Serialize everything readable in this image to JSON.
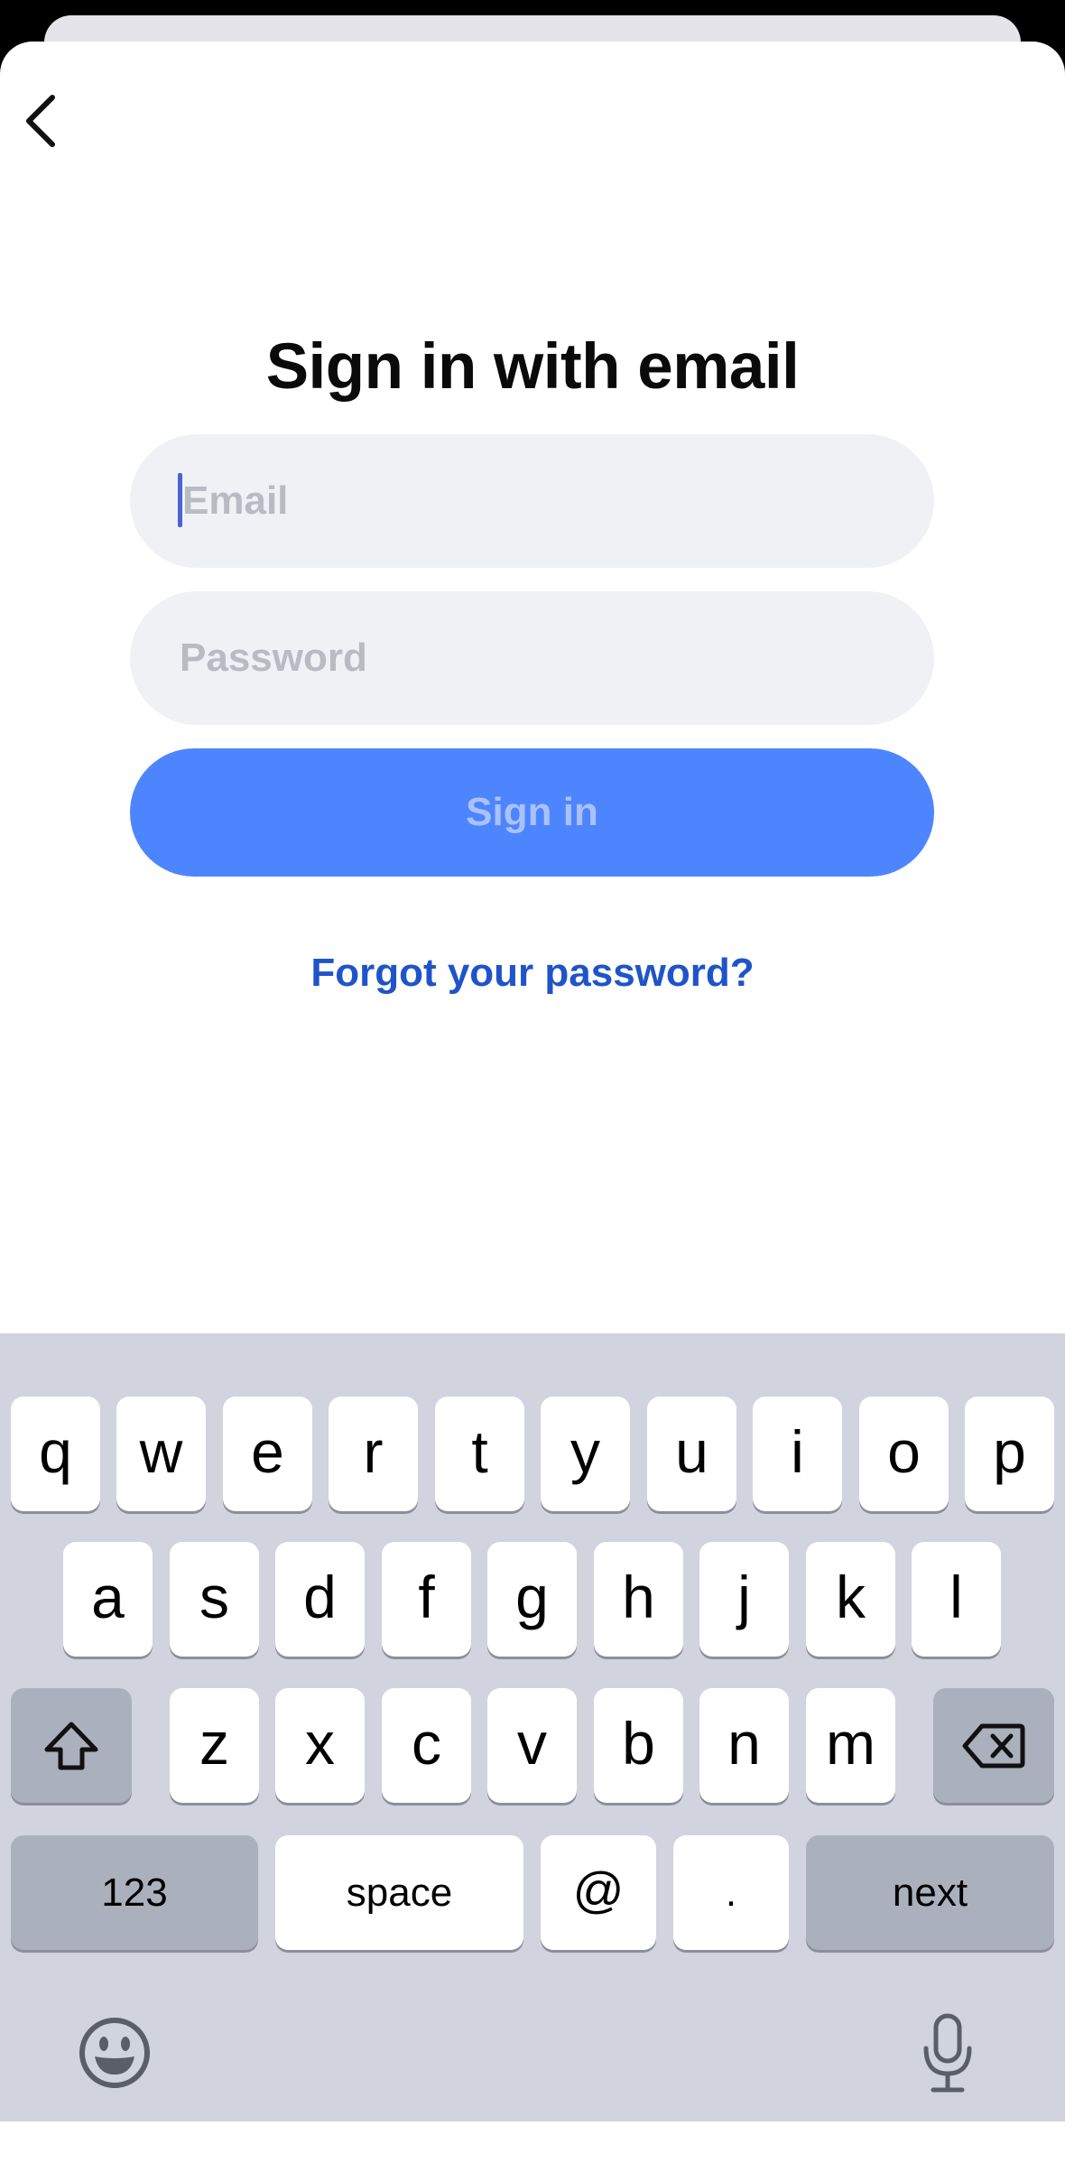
{
  "screen": {
    "title": "Sign in with email",
    "email": {
      "value": "",
      "placeholder": "Email"
    },
    "password": {
      "value": "",
      "placeholder": "Password"
    },
    "sign_in_label": "Sign in",
    "forgot_label": "Forgot your password?"
  },
  "keyboard": {
    "row1": [
      "q",
      "w",
      "e",
      "r",
      "t",
      "y",
      "u",
      "i",
      "o",
      "p"
    ],
    "row2": [
      "a",
      "s",
      "d",
      "f",
      "g",
      "h",
      "j",
      "k",
      "l"
    ],
    "row3": [
      "z",
      "x",
      "c",
      "v",
      "b",
      "n",
      "m"
    ],
    "numbers_label": "123",
    "space_label": "space",
    "at_label": "@",
    "dot_label": ".",
    "next_label": "next"
  },
  "icons": {
    "back": "chevron-left-icon",
    "shift": "shift-icon",
    "delete": "backspace-icon",
    "emoji": "emoji-icon",
    "dictation": "microphone-icon"
  },
  "colors": {
    "accent": "#4d85fe",
    "link": "#1f54c9",
    "field_bg": "#f0f1f5",
    "keyboard_bg": "#d1d4de"
  }
}
